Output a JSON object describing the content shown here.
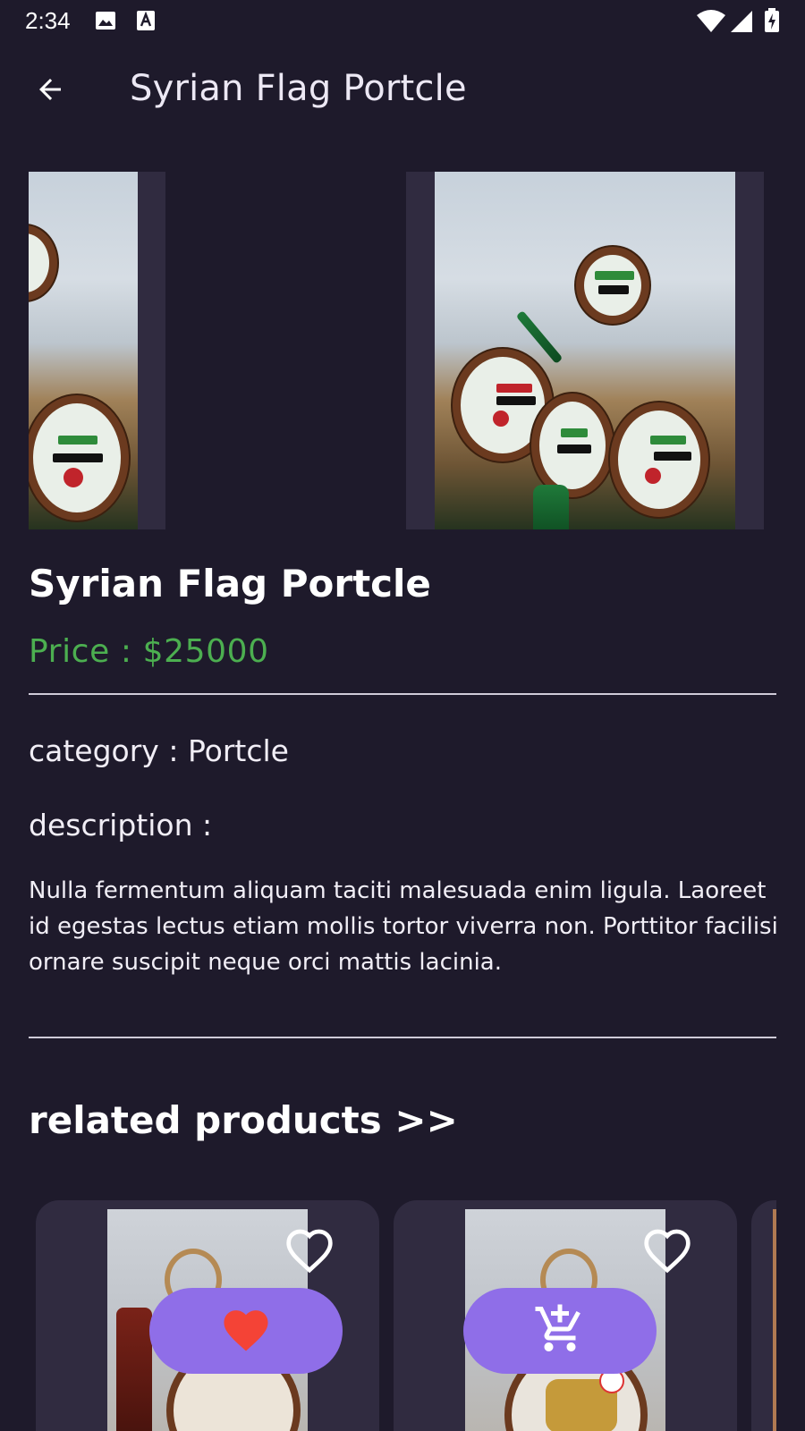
{
  "status_bar": {
    "time": "2:34",
    "icons": [
      "image-icon",
      "a-text-icon",
      "wifi-icon",
      "signal-icon",
      "battery-charging-icon"
    ]
  },
  "app_bar": {
    "back_icon": "arrow-left-icon",
    "title": "Syrian Flag Portcle"
  },
  "product": {
    "name": "Syrian Flag Portcle",
    "price": "Price : $25000",
    "category": "category : Portcle",
    "description_label": "description :",
    "description": "Nulla fermentum aliquam taciti malesuada enim ligula. Laoreet id egestas lectus etiam mollis tortor viverra non. Porttitor facilisi ornare suscipit neque orci mattis lacinia."
  },
  "related": {
    "heading": "related products >>",
    "cards": [
      {
        "fav_icon": "heart-outline-icon",
        "action_icon": "heart-filled-icon"
      },
      {
        "fav_icon": "heart-outline-icon",
        "action_icon": "add-to-cart-icon"
      }
    ]
  },
  "colors": {
    "background": "#1e1a2b",
    "surface": "#302b40",
    "price": "#4caf50",
    "accent": "#8f6ee8",
    "heart": "#f44336"
  }
}
